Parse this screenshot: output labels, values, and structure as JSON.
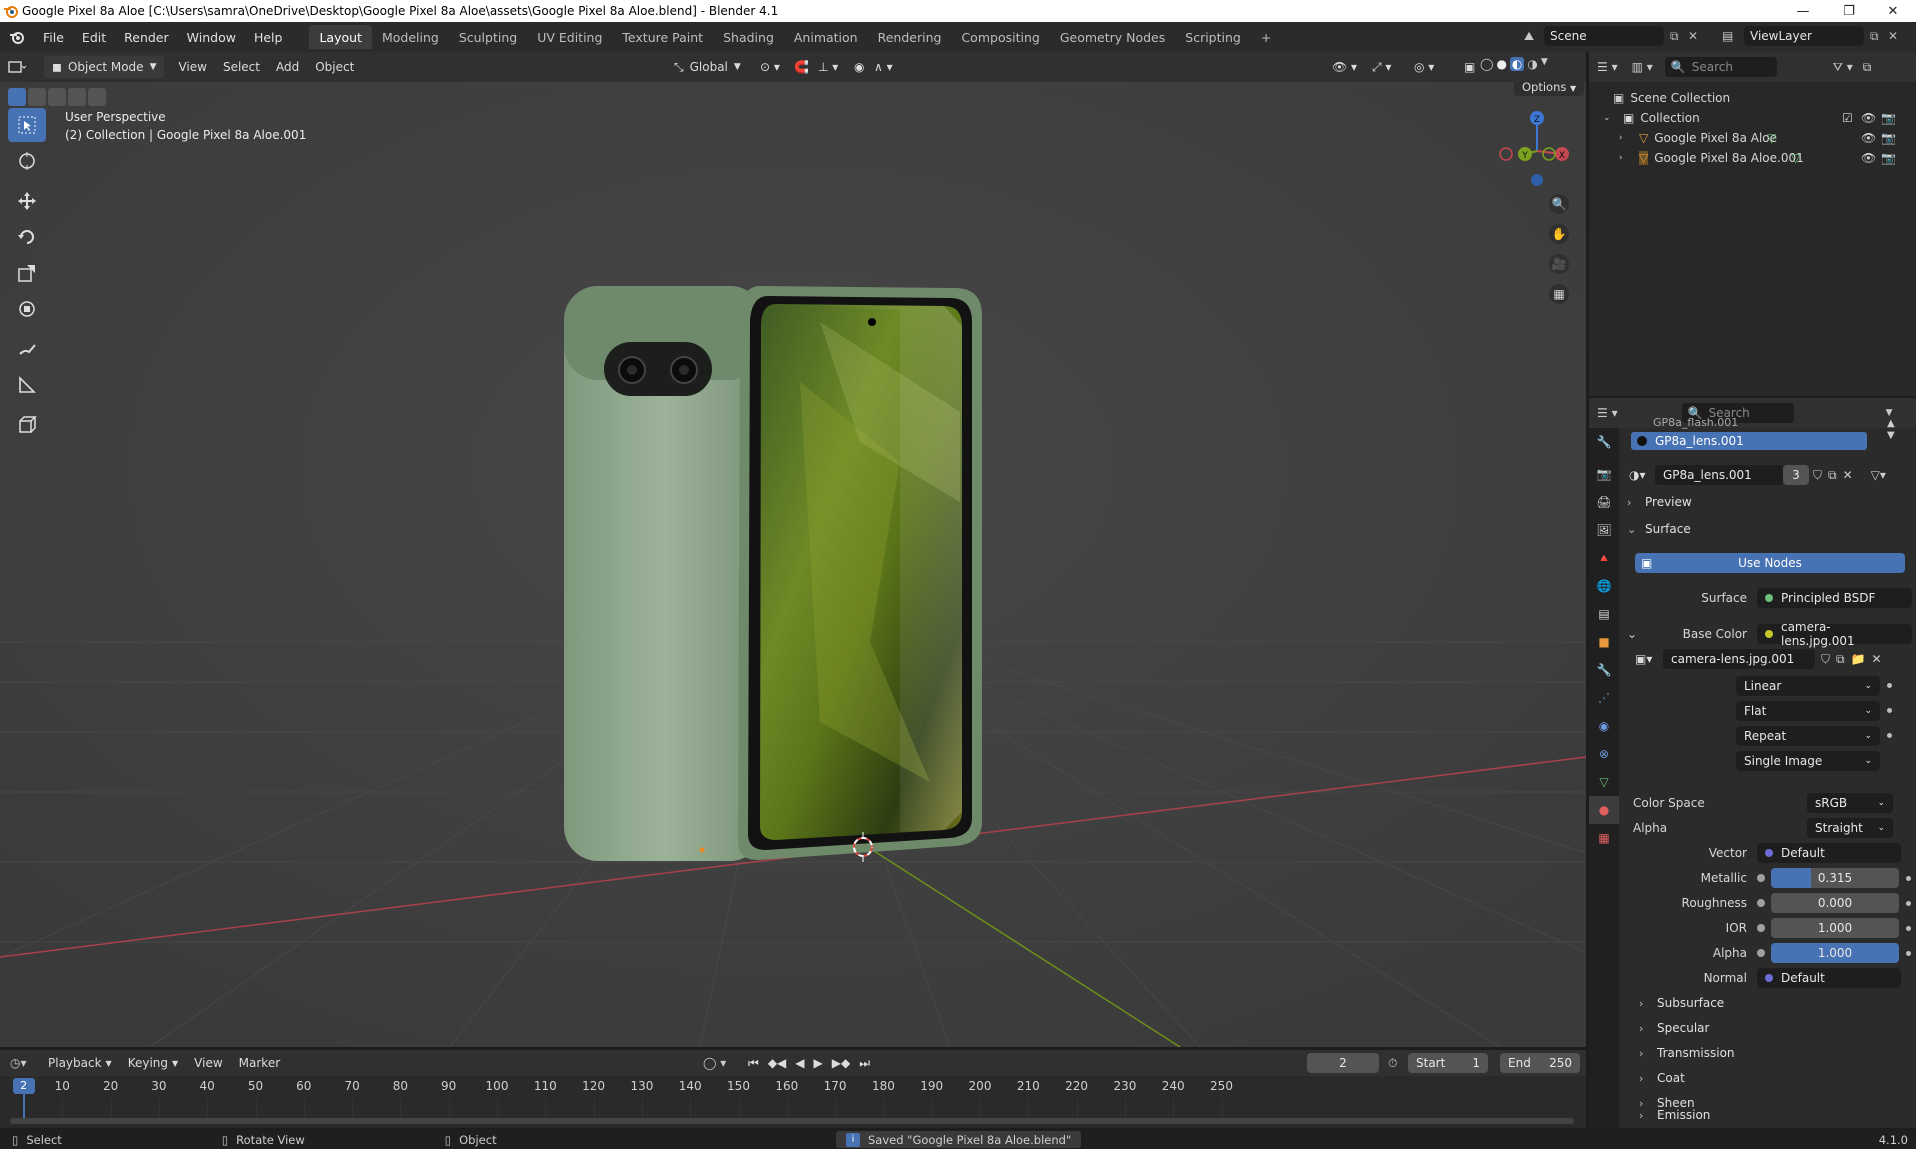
{
  "window": {
    "title": "Google Pixel 8a Aloe [C:\\Users\\samra\\OneDrive\\Desktop\\Google Pixel 8a Aloe\\assets\\Google Pixel 8a Aloe.blend] - Blender 4.1",
    "minimize": "—",
    "maximize": "❐",
    "close": "✕"
  },
  "menu": [
    "File",
    "Edit",
    "Render",
    "Window",
    "Help"
  ],
  "workspaces": [
    "Layout",
    "Modeling",
    "Sculpting",
    "UV Editing",
    "Texture Paint",
    "Shading",
    "Animation",
    "Rendering",
    "Compositing",
    "Geometry Nodes",
    "Scripting"
  ],
  "workspace_add": "+",
  "active_workspace": "Layout",
  "scene": "Scene",
  "view_layer": "ViewLayer",
  "viewport_header": {
    "mode": "Object Mode",
    "menus": [
      "View",
      "Select",
      "Add",
      "Object"
    ],
    "orientation": "Global",
    "options": "Options"
  },
  "viewport": {
    "perspective": "User Perspective",
    "collection_info": "(2) Collection | Google Pixel 8a Aloe.001",
    "gizmo": {
      "z": "Z",
      "y": "Y",
      "x": "X"
    }
  },
  "outliner": {
    "search_placeholder": "Search",
    "root": "Scene Collection",
    "collection": "Collection",
    "items": [
      "Google Pixel 8a Aloe",
      "Google Pixel 8a Aloe.001"
    ]
  },
  "properties": {
    "search_placeholder": "Search",
    "slot_above": "GP8a_flash.001",
    "active_slot": "GP8a_lens.001",
    "material_name": "GP8a_lens.001",
    "user_count": "3",
    "preview": "Preview",
    "surface_section": "Surface",
    "use_nodes": "Use Nodes",
    "surface_label": "Surface",
    "surface_value": "Principled BSDF",
    "base_color_label": "Base Color",
    "base_color_value": "camera-lens.jpg.001",
    "image_name": "camera-lens.jpg.001",
    "interpolation": "Linear",
    "projection": "Flat",
    "extension": "Repeat",
    "source": "Single Image",
    "color_space_label": "Color Space",
    "color_space": "sRGB",
    "alpha_label": "Alpha",
    "alpha_mode": "Straight",
    "vector_label": "Vector",
    "vector_value": "Default",
    "metallic_label": "Metallic",
    "metallic_value": "0.315",
    "metallic_fraction": 0.315,
    "roughness_label": "Roughness",
    "roughness_value": "0.000",
    "ior_label": "IOR",
    "ior_value": "1.000",
    "alpha2_label": "Alpha",
    "alpha2_value": "1.000",
    "alpha2_fraction": 1.0,
    "normal_label": "Normal",
    "normal_value": "Default",
    "subsections": [
      "Subsurface",
      "Specular",
      "Transmission",
      "Coat",
      "Sheen",
      "Emission"
    ]
  },
  "timeline": {
    "menus": [
      "Playback",
      "Keying",
      "View",
      "Marker"
    ],
    "current_frame": "2",
    "start_label": "Start",
    "start": "1",
    "end_label": "End",
    "end": "250",
    "ticks": [
      "10",
      "20",
      "30",
      "40",
      "50",
      "60",
      "70",
      "80",
      "90",
      "100",
      "110",
      "120",
      "130",
      "140",
      "150",
      "160",
      "170",
      "180",
      "190",
      "200",
      "210",
      "220",
      "230",
      "240",
      "250"
    ]
  },
  "status": {
    "select": "Select",
    "rotate": "Rotate View",
    "object": "Object",
    "message": "Saved \"Google Pixel 8a Aloe.blend\"",
    "version": "4.1.0"
  },
  "colors": {
    "accent": "#4772b3",
    "viewport_bg": "#3f3f3f",
    "x_axis": "#c5474f",
    "y_axis": "#7ba31f",
    "z_axis": "#3c78d8"
  }
}
